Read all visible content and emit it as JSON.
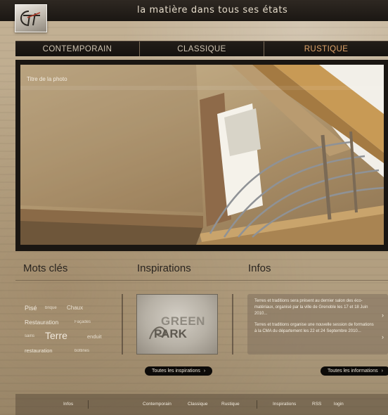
{
  "header": {
    "tagline": "la matière dans tous ses états",
    "logo_text": "tt"
  },
  "nav": {
    "items": [
      "CONTEMPORAIN",
      "CLASSIQUE",
      "RUSTIQUE"
    ],
    "active_color": "#e0a46a"
  },
  "photo": {
    "caption": "Titre de la photo"
  },
  "sections": {
    "keywords_title": "Mots clés",
    "inspirations_title": "Inspirations",
    "infos_title": "Infos"
  },
  "tagcloud": [
    "Pisé",
    "brique",
    "Chaux",
    "Restauration",
    "Façades",
    "sains",
    "Terre",
    "enduit",
    "restauration",
    "bottines"
  ],
  "inspiration": {
    "image_text_top": "GREEN",
    "image_text_bottom": "PARK",
    "button_label": "Toutes les inspirations"
  },
  "infos": {
    "items": [
      "Terres et traditions sera présent au dernier salon des éco-matériaux, organisé par la ville de Grenoble les 17 et 18 Juin 2010...",
      "Terres et traditions organise une nouvelle session de formations à la CMA du département les 22 et 24 Septembre 2010..."
    ],
    "button_label": "Toutes les informations"
  },
  "footer": {
    "links": [
      "Infos",
      "Contemporain",
      "Classique",
      "Rustique",
      "Inspirations",
      "RSS",
      "login"
    ]
  },
  "colors": {
    "nav_bg": "#1b1713",
    "accent": "#e0a46a",
    "text_dark": "#2a2520"
  }
}
